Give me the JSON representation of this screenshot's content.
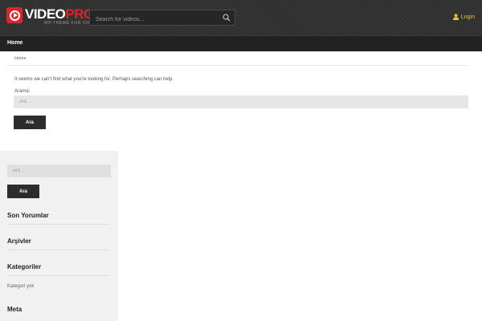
{
  "header": {
    "logo_main": "VIDEO",
    "logo_accent": "PRO",
    "logo_tagline": "WP THEME FOR VIDEO",
    "search_placeholder": "Search for videos...",
    "login_label": "Login"
  },
  "nav": {
    "home_label": "Home"
  },
  "main": {
    "breadcrumb": "Home",
    "not_found_text": "It seems we can't find what you're looking for. Perhaps searching can help.",
    "search_label": "Arama:",
    "search_placeholder": "Ara ...",
    "search_button": "Ara"
  },
  "sidebar": {
    "search_placeholder": "Ara ...",
    "search_button": "Ara",
    "widgets": [
      {
        "title": "Son Yorumlar"
      },
      {
        "title": "Arşivler"
      },
      {
        "title": "Kategoriler",
        "body": "Kategori yok"
      },
      {
        "title": "Meta"
      }
    ]
  },
  "colors": {
    "brand_red": "#d9262c",
    "login_yellow": "#f0c43a",
    "header_bg": "#333333",
    "nav_bg": "#222222"
  },
  "icons": [
    "play-logo-icon",
    "search-icon",
    "user-icon"
  ]
}
